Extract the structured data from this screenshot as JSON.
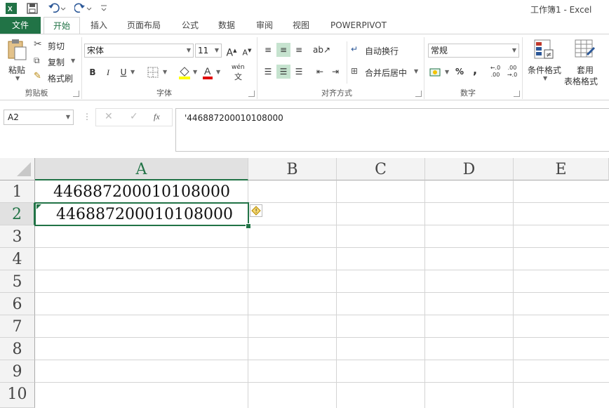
{
  "window": {
    "title": "工作簿1 - Excel"
  },
  "tabs": [
    {
      "label": "文件"
    },
    {
      "label": "开始"
    },
    {
      "label": "插入"
    },
    {
      "label": "页面布局"
    },
    {
      "label": "公式"
    },
    {
      "label": "数据"
    },
    {
      "label": "审阅"
    },
    {
      "label": "视图"
    },
    {
      "label": "POWERPIVOT"
    }
  ],
  "clipboard": {
    "paste": "粘贴",
    "cut": "剪切",
    "copy": "复制",
    "format_painter": "格式刷",
    "group": "剪贴板"
  },
  "font": {
    "name": "宋体",
    "size": "11",
    "bold": "B",
    "italic": "I",
    "underline": "U",
    "phonetic": "wén",
    "group": "字体"
  },
  "alignment": {
    "wrap": "自动换行",
    "merge": "合并后居中",
    "group": "对齐方式"
  },
  "number": {
    "format": "常规",
    "percent": "%",
    "comma": ",",
    "group": "数字"
  },
  "styles": {
    "conditional": "条件格式",
    "table_line1": "套用",
    "table_line2": "表格格式"
  },
  "formula_bar": {
    "name_box": "A2",
    "fx": "fx",
    "content": "'446887200010108000"
  },
  "sheet": {
    "columns": [
      "A",
      "B",
      "C",
      "D",
      "E"
    ],
    "rows": [
      "1",
      "2",
      "3",
      "4",
      "5",
      "6",
      "7",
      "8",
      "9",
      "10"
    ],
    "cells": {
      "A1": "446887200010108000",
      "A2": "446887200010108000"
    },
    "selected": "A2"
  },
  "colors": {
    "accent": "#217346",
    "grid": "#d4d4d4",
    "header_bg": "#f3f3f3"
  }
}
